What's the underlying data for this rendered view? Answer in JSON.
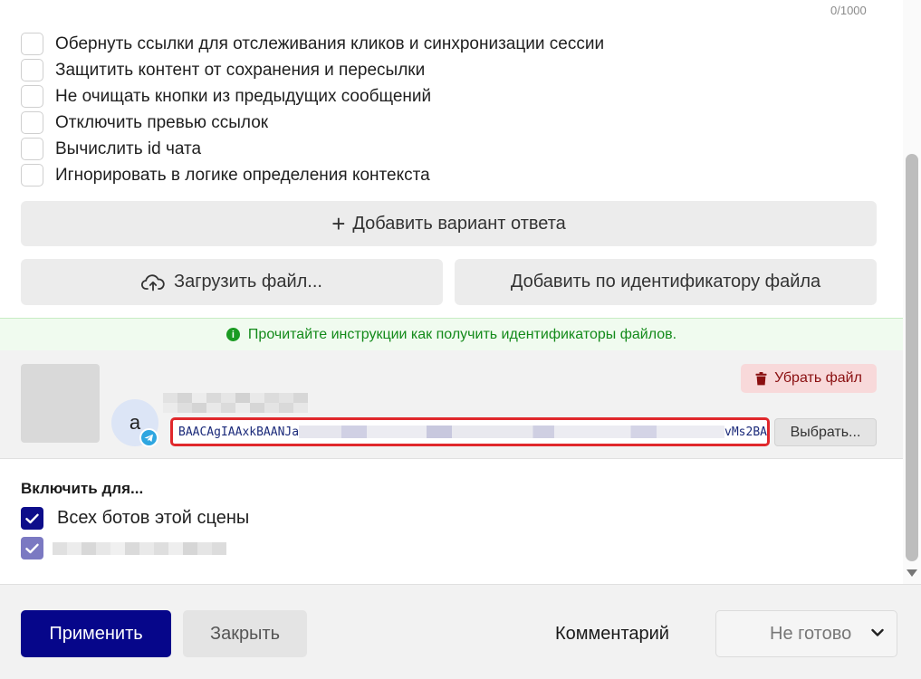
{
  "counter": "0/1000",
  "options": [
    {
      "label": "Обернуть ссылки для отслеживания кликов и синхронизации сессии",
      "checked": false
    },
    {
      "label": "Защитить контент от сохранения и пересылки",
      "checked": false
    },
    {
      "label": "Не очищать кнопки из предыдущих сообщений",
      "checked": false
    },
    {
      "label": "Отключить превью ссылок",
      "checked": false
    },
    {
      "label": "Вычислить id чата",
      "checked": false
    },
    {
      "label": "Игнорировать в логике определения контекста",
      "checked": false
    }
  ],
  "buttons": {
    "add_answer": "Добавить вариант ответа",
    "upload_file": "Загрузить файл...",
    "add_by_id": "Добавить по идентификатору файла"
  },
  "info": {
    "text": "Прочитайте инструкции как получить идентификаторы файлов."
  },
  "file": {
    "avatar_letter": "a",
    "remove_label": "Убрать файл",
    "id_prefix": "BAACAgIAAxkBAANJa",
    "id_suffix": "vMs2BA",
    "choose_label": "Выбрать..."
  },
  "enable": {
    "title": "Включить для...",
    "all_bots_label": "Всех ботов этой сцены"
  },
  "footer": {
    "apply": "Применить",
    "close": "Закрыть",
    "comment": "Комментарий",
    "status": "Не готово"
  },
  "colors": {
    "primary": "#06068a",
    "danger_bg": "#f8d9da",
    "danger_text": "#8a0f10",
    "info_text": "#138a1a",
    "highlight_border": "#e0282c"
  },
  "icons": {
    "add": "plus-icon",
    "upload": "cloud-upload-icon",
    "info": "info-icon",
    "remove": "trash-icon",
    "messenger": "telegram-icon",
    "check": "checkmark-icon",
    "dropdown": "chevron-down-icon"
  }
}
